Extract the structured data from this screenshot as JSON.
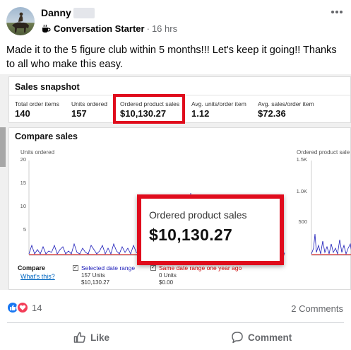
{
  "post": {
    "author": "Danny",
    "badge": "Conversation Starter",
    "time": "16 hrs",
    "separator": "·",
    "text": "Made it to the 5 figure club within 5 months!!! Let's keep it going!! Thanks to all who make this easy.",
    "more_icon": "more-horizontal-icon"
  },
  "screenshot": {
    "snapshot": {
      "title": "Sales snapshot",
      "stats": [
        {
          "label": "Total order items",
          "value": "140"
        },
        {
          "label": "Units ordered",
          "value": "157"
        },
        {
          "label": "Ordered product sales",
          "value": "$10,130.27"
        },
        {
          "label": "Avg. units/order item",
          "value": "1.12"
        },
        {
          "label": "Avg. sales/order item",
          "value": "$72.36"
        }
      ]
    },
    "compare": {
      "title": "Compare sales",
      "left_axis_label": "Units ordered",
      "left_ticks": [
        "20",
        "15",
        "10",
        "5"
      ],
      "right_axis_label": "Ordered product sale",
      "right_ticks": [
        "1.5K",
        "1.0K",
        "500"
      ],
      "legend": {
        "compare_label": "Compare",
        "what_link": "What's this?",
        "selected": {
          "name": "Selected date range",
          "units": "157 Units",
          "sales": "$10,130.27",
          "color": "#1a1ab8"
        },
        "previous": {
          "name": "Same date range one year ago",
          "units": "0 Units",
          "sales": "$0.00",
          "color": "#d40000"
        },
        "check_mark": "✓"
      }
    },
    "zoom": {
      "label": "Ordered product sales",
      "value": "$10,130.27",
      "border_color": "#e00b1c"
    }
  },
  "footer": {
    "reaction_count": "14",
    "comments": "2 Comments",
    "like_label": "Like",
    "comment_label": "Comment",
    "like_color": "#1877f2",
    "love_color": "#f33e58"
  }
}
